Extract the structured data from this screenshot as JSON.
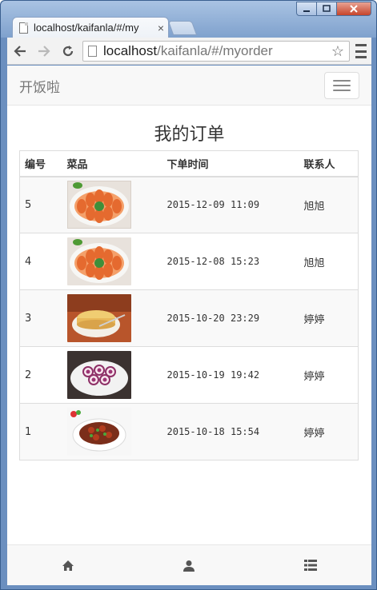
{
  "browser": {
    "tab_title": "localhost/kaifanla/#/my",
    "tab_close": "×",
    "url_host": "localhost",
    "url_path": "/kaifanla/#/myorder"
  },
  "app": {
    "brand": "开饭啦",
    "page_title": "我的订单"
  },
  "table": {
    "headers": {
      "id": "编号",
      "dish": "菜品",
      "time": "下单时间",
      "contact": "联系人"
    },
    "rows": [
      {
        "id": "5",
        "time": "2015-12-09 11:09",
        "contact": "旭旭",
        "dish_image": "papaya-slices-icon"
      },
      {
        "id": "4",
        "time": "2015-12-08 15:23",
        "contact": "旭旭",
        "dish_image": "papaya-slices-icon"
      },
      {
        "id": "3",
        "time": "2015-10-20 23:29",
        "contact": "婷婷",
        "dish_image": "cake-icon"
      },
      {
        "id": "2",
        "time": "2015-10-19 19:42",
        "contact": "婷婷",
        "dish_image": "rice-rolls-icon"
      },
      {
        "id": "1",
        "time": "2015-10-18 15:54",
        "contact": "婷婷",
        "dish_image": "stir-fry-bowl-icon"
      }
    ]
  },
  "footer": {
    "items": [
      "home-icon",
      "user-icon",
      "list-icon"
    ]
  },
  "colors": {
    "navbar_bg": "#f8f8f8",
    "stripe_bg": "#f9f9f9",
    "border": "#dddddd"
  }
}
